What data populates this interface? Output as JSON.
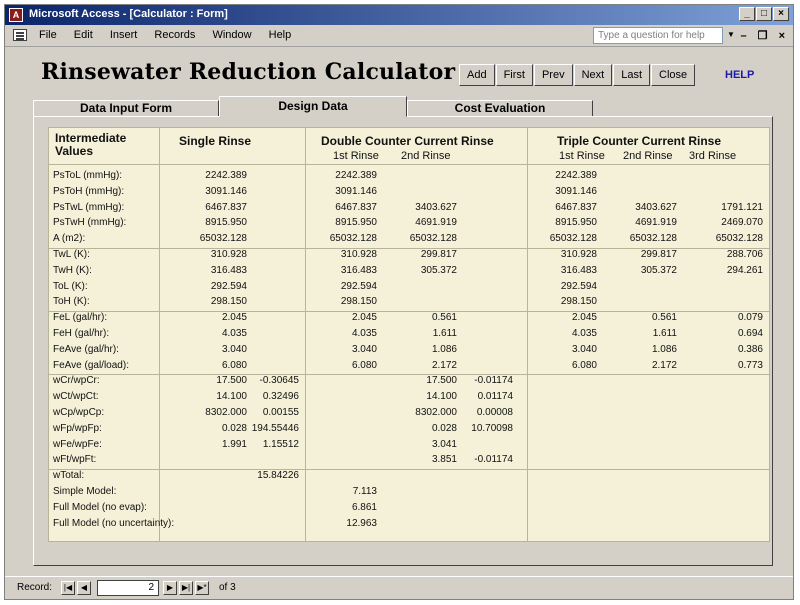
{
  "window": {
    "title": "Microsoft Access - [Calculator : Form]",
    "app_icon": "access-icon"
  },
  "menu": {
    "items": [
      "File",
      "Edit",
      "Insert",
      "Records",
      "Window",
      "Help"
    ],
    "question_placeholder": "Type a question for help"
  },
  "form": {
    "heading": "Rinsewater Reduction Calculator",
    "buttons": [
      "Add",
      "First",
      "Prev",
      "Next",
      "Last",
      "Close"
    ],
    "help": "HELP",
    "tabs": [
      "Data Input Form",
      "Design Data",
      "Cost Evaluation"
    ],
    "active_tab": "Design Data"
  },
  "table": {
    "headers": {
      "intermediate": "Intermediate Values",
      "single": "Single Rinse",
      "double": "Double Counter Current Rinse",
      "triple": "Triple Counter Current Rinse",
      "first": "1st Rinse",
      "second": "2nd Rinse",
      "third": "3rd Rinse"
    },
    "rows": [
      {
        "label": "PsToL (mmHg):",
        "s1": "2242.389",
        "s2": "",
        "d1": "2242.389",
        "d2": "",
        "t1": "2242.389",
        "t2": "",
        "t3": ""
      },
      {
        "label": "PsToH (mmHg):",
        "s1": "3091.146",
        "s2": "",
        "d1": "3091.146",
        "d2": "",
        "t1": "3091.146",
        "t2": "",
        "t3": ""
      },
      {
        "label": "PsTwL (mmHg):",
        "s1": "6467.837",
        "s2": "",
        "d1": "6467.837",
        "d2": "3403.627",
        "t1": "6467.837",
        "t2": "3403.627",
        "t3": "1791.121"
      },
      {
        "label": "PsTwH (mmHg):",
        "s1": "8915.950",
        "s2": "",
        "d1": "8915.950",
        "d2": "4691.919",
        "t1": "8915.950",
        "t2": "4691.919",
        "t3": "2469.070"
      },
      {
        "label": "A (m2):",
        "s1": "65032.128",
        "s2": "",
        "d1": "65032.128",
        "d2": "65032.128",
        "t1": "65032.128",
        "t2": "65032.128",
        "t3": "65032.128"
      },
      {
        "label": "TwL (K):",
        "s1": "310.928",
        "s2": "",
        "d1": "310.928",
        "d2": "299.817",
        "t1": "310.928",
        "t2": "299.817",
        "t3": "288.706"
      },
      {
        "label": "TwH (K):",
        "s1": "316.483",
        "s2": "",
        "d1": "316.483",
        "d2": "305.372",
        "t1": "316.483",
        "t2": "305.372",
        "t3": "294.261"
      },
      {
        "label": "ToL (K):",
        "s1": "292.594",
        "s2": "",
        "d1": "292.594",
        "d2": "",
        "t1": "292.594",
        "t2": "",
        "t3": ""
      },
      {
        "label": "ToH (K):",
        "s1": "298.150",
        "s2": "",
        "d1": "298.150",
        "d2": "",
        "t1": "298.150",
        "t2": "",
        "t3": ""
      },
      {
        "label": "FeL (gal/hr):",
        "s1": "2.045",
        "s2": "",
        "d1": "2.045",
        "d2": "0.561",
        "t1": "2.045",
        "t2": "0.561",
        "t3": "0.079"
      },
      {
        "label": "FeH (gal/hr):",
        "s1": "4.035",
        "s2": "",
        "d1": "4.035",
        "d2": "1.611",
        "t1": "4.035",
        "t2": "1.611",
        "t3": "0.694"
      },
      {
        "label": "FeAve (gal/hr):",
        "s1": "3.040",
        "s2": "",
        "d1": "3.040",
        "d2": "1.086",
        "t1": "3.040",
        "t2": "1.086",
        "t3": "0.386"
      },
      {
        "label": "FeAve (gal/load):",
        "s1": "6.080",
        "s2": "",
        "d1": "6.080",
        "d2": "2.172",
        "t1": "6.080",
        "t2": "2.172",
        "t3": "0.773"
      },
      {
        "label": "wCr/wpCr:",
        "s1": "17.500",
        "s2": "-0.30645",
        "d1": "",
        "d2": "17.500",
        "d3": "-0.01174",
        "t1": "",
        "t2": "",
        "t3": ""
      },
      {
        "label": "wCt/wpCt:",
        "s1": "14.100",
        "s2": "0.32496",
        "d1": "",
        "d2": "14.100",
        "d3": "0.01174",
        "t1": "",
        "t2": "",
        "t3": ""
      },
      {
        "label": "wCp/wpCp:",
        "s1": "8302.000",
        "s2": "0.00155",
        "d1": "",
        "d2": "8302.000",
        "d3": "0.00008",
        "t1": "",
        "t2": "",
        "t3": ""
      },
      {
        "label": "wFp/wpFp:",
        "s1": "0.028",
        "s2": "194.55446",
        "d1": "",
        "d2": "0.028",
        "d3": "10.70098",
        "t1": "",
        "t2": "",
        "t3": ""
      },
      {
        "label": "wFe/wpFe:",
        "s1": "1.991",
        "s2": "1.15512",
        "d1": "",
        "d2": "3.041",
        "d3": "",
        "t1": "",
        "t2": "",
        "t3": ""
      },
      {
        "label": "wFt/wpFt:",
        "s1": "",
        "s2": "",
        "d1": "",
        "d2": "3.851",
        "d3": "-0.01174",
        "t1": "",
        "t2": "",
        "t3": ""
      },
      {
        "label": "wTotal:",
        "s1": "",
        "s2": "15.84226",
        "d1": "",
        "d2": "",
        "t1": "",
        "t2": "",
        "t3": ""
      },
      {
        "label": "Simple Model:",
        "s1": "",
        "s2": "",
        "d1": "7.113",
        "d2": "",
        "t1": "",
        "t2": "",
        "t3": ""
      },
      {
        "label": "Full Model (no evap):",
        "s1": "",
        "s2": "",
        "d1": "6.861",
        "d2": "",
        "t1": "",
        "t2": "",
        "t3": ""
      },
      {
        "label": "Full Model (no uncertainty):",
        "s1": "",
        "s2": "",
        "d1": "12.963",
        "d2": "",
        "t1": "",
        "t2": "",
        "t3": ""
      }
    ]
  },
  "record": {
    "label": "Record:",
    "current": "2",
    "of": "of 3"
  }
}
